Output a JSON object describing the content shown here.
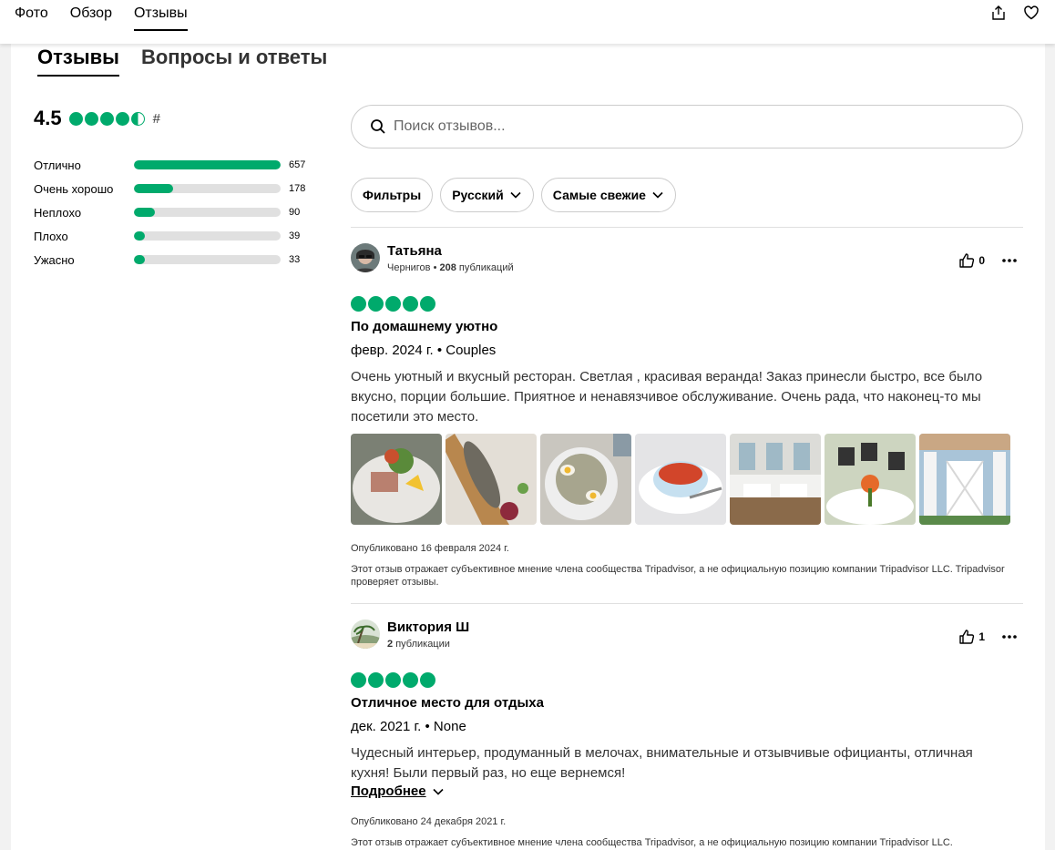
{
  "topnav": {
    "tabs": [
      "Фото",
      "Обзор",
      "Отзывы"
    ]
  },
  "section_tabs": [
    "Отзывы",
    "Вопросы и ответы"
  ],
  "rating": {
    "value": "4.5",
    "bubbles": 4.5,
    "hash": "#",
    "distribution": [
      {
        "label": "Отлично",
        "count": "657",
        "share": 1.0
      },
      {
        "label": "Очень хорошо",
        "count": "178",
        "share": 0.27
      },
      {
        "label": "Неплохо",
        "count": "90",
        "share": 0.14
      },
      {
        "label": "Плохо",
        "count": "39",
        "share": 0.06
      },
      {
        "label": "Ужасно",
        "count": "33",
        "share": 0.05
      }
    ]
  },
  "search": {
    "placeholder": "Поиск отзывов..."
  },
  "filters": {
    "filter_label": "Фильтры",
    "language_label": "Русский",
    "sort_label": "Самые свежие"
  },
  "reviews": [
    {
      "name": "Татьяна",
      "location": "Чернигов",
      "pubs_count": "208",
      "pubs_label": "публикаций",
      "likes": "0",
      "rating": 5,
      "title": "По домашнему уютно",
      "date": "февр. 2024 г. • Couples",
      "text": "Очень уютный и вкусный ресторан. Светлая , красивая веранда! Заказ принесли быстро, все было вкусно, порции большие. Приятное и ненавязчивое обслуживание. Очень рада, что наконец-то мы посетили это место.",
      "published": "Опубликовано 16 февраля 2024 г.",
      "disclaimer": "Этот отзыв отражает субъективное мнение члена сообщества Tripadvisor, а не официальную позицию компании Tripadvisor LLC. Tripadvisor проверяет отзывы."
    },
    {
      "name": "Виктория Ш",
      "pubs_count": "2",
      "pubs_label": "публикации",
      "likes": "1",
      "rating": 5,
      "title": "Отличное место для отдыха",
      "date": "дек. 2021 г. • None",
      "text": "Чудесный интерьер, продуманный в мелочах, внимательные и отзывчивые официанты, отличная кухня! Были первый раз, но еще вернемся!",
      "read_more": "Подробнее",
      "published": "Опубликовано 24 декабря 2021 г.",
      "disclaimer": "Этот отзыв отражает субъективное мнение члена сообщества Tripadvisor, а не официальную позицию компании Tripadvisor LLC."
    }
  ],
  "colors": {
    "accent": "#00aa6c",
    "track": "#e0e0e0"
  }
}
